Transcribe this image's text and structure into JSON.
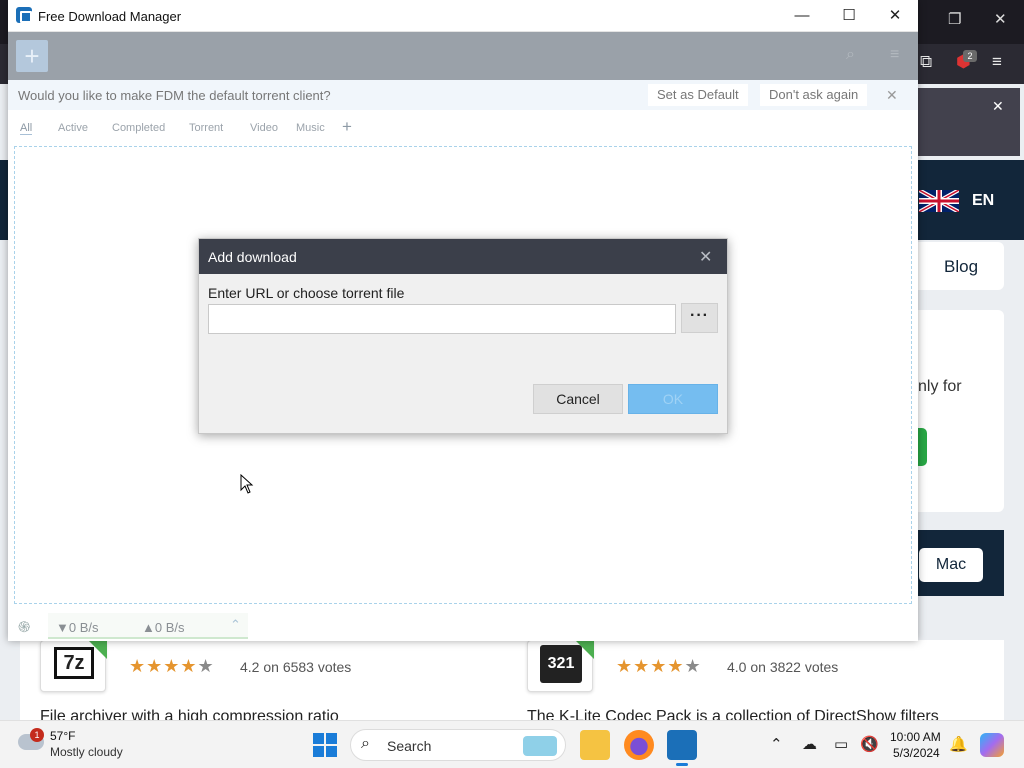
{
  "fdm": {
    "window_title": "Free Download Manager",
    "prompt": {
      "question": "Would you like to make FDM the default torrent client?",
      "set_default": "Set as Default",
      "dont_ask": "Don't ask again"
    },
    "filters": [
      "All",
      "Active",
      "Completed",
      "Torrent",
      "Video",
      "Music"
    ],
    "status": {
      "download_speed": "▼0 B/s",
      "upload_speed": "▲0 B/s"
    }
  },
  "dialog": {
    "title": "Add download",
    "label": "Enter URL or choose torrent file",
    "url_value": "",
    "browse_label": "···",
    "cancel_label": "Cancel",
    "ok_label": "OK"
  },
  "website": {
    "language": "EN",
    "blog_label": "Blog",
    "only_for_text": "nly for",
    "mac_label": "Mac",
    "extension_badge": "2",
    "apps": [
      {
        "name": "7z",
        "rating_text": "4.2 on 6583 votes",
        "description": "File archiver with a high compression ratio"
      },
      {
        "name": "321",
        "rating_text": "4.0 on 3822 votes",
        "description": "The K-Lite Codec Pack is a collection of DirectShow filters"
      }
    ]
  },
  "taskbar": {
    "weather_badge": "1",
    "temperature": "57°F",
    "condition": "Mostly cloudy",
    "search_label": "Search",
    "time": "10:00 AM",
    "date": "5/3/2024"
  },
  "colors": {
    "accent": "#1a7cd8",
    "dialog_header": "#3b3f4a",
    "ok_disabled": "#75bdf0",
    "star": "#e5952f"
  }
}
